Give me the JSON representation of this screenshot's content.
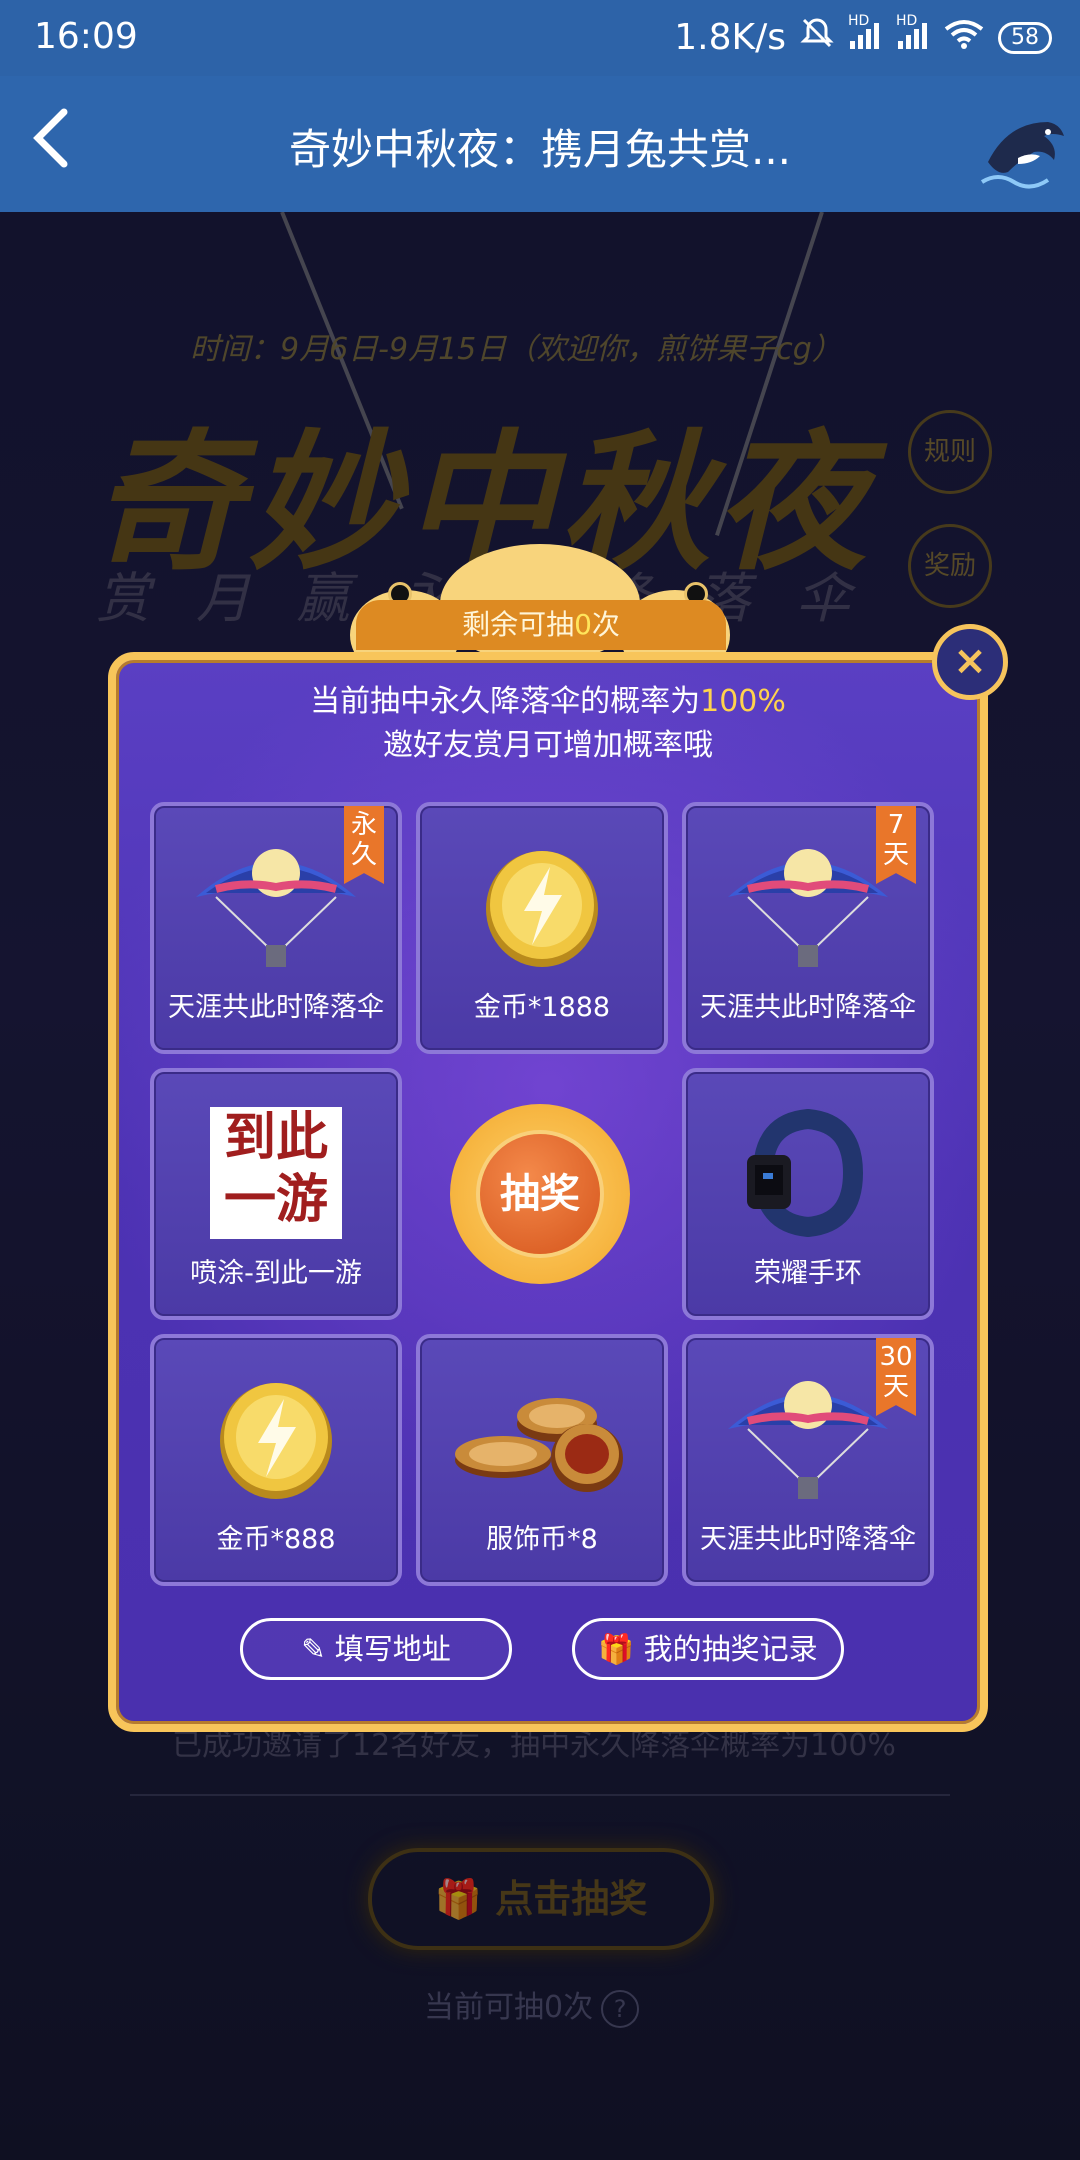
{
  "status_bar": {
    "time": "16:09",
    "speed": "1.8K/s",
    "signal_label_1": "HD",
    "signal_label_2": "HD",
    "battery": "58"
  },
  "header": {
    "title": "奇妙中秋夜：携月兔共赏..."
  },
  "background": {
    "time_text": "时间：9月6日-9月15日（欢迎你，煎饼果子cg）",
    "big_title": "奇妙中秋夜",
    "sub_title": "赏月赢永久降落伞",
    "rules_label": "规则",
    "rewards_label": "奖励",
    "invited_text": "已成功邀请了12名好友，抽中永久降落伞概率为100%",
    "draw_button_label": "点击抽奖",
    "remain_text": "当前可抽0次",
    "help_label": "?"
  },
  "modal": {
    "remain_prefix": "剩余可抽",
    "remain_count": "0",
    "remain_suffix": "次",
    "close_label": "×",
    "prob_line1_prefix": "当前抽中永久降落伞的概率为",
    "prob_value": "100%",
    "prob_line2": "邀好友赏月可增加概率哦",
    "prizes": [
      {
        "label": "天涯共此时降落伞",
        "tag": "永久",
        "icon": "parachute-icon"
      },
      {
        "label": "金币*1888",
        "tag": "",
        "icon": "gold-coin-icon"
      },
      {
        "label": "天涯共此时降落伞",
        "tag": "7天",
        "icon": "parachute-icon"
      },
      {
        "label": "喷涂-到此一游",
        "tag": "",
        "icon": "graffiti-icon",
        "art_text": "到此一游"
      },
      {
        "label": "荣耀手环",
        "tag": "",
        "icon": "fitness-band-icon"
      },
      {
        "label": "金币*888",
        "tag": "",
        "icon": "gold-coin-icon"
      },
      {
        "label": "服饰币*8",
        "tag": "",
        "icon": "coin-stack-icon"
      },
      {
        "label": "天涯共此时降落伞",
        "tag": "30天",
        "icon": "parachute-icon"
      }
    ],
    "draw_label": "抽奖",
    "fill_address_label": "填写地址",
    "records_label": "我的抽奖记录"
  },
  "colors": {
    "header_bg": "#2e66ad",
    "modal_bg": "#4c32b3",
    "modal_border": "#f8c55a",
    "highlight": "#ffd34d",
    "tag_orange": "#e9762a"
  }
}
